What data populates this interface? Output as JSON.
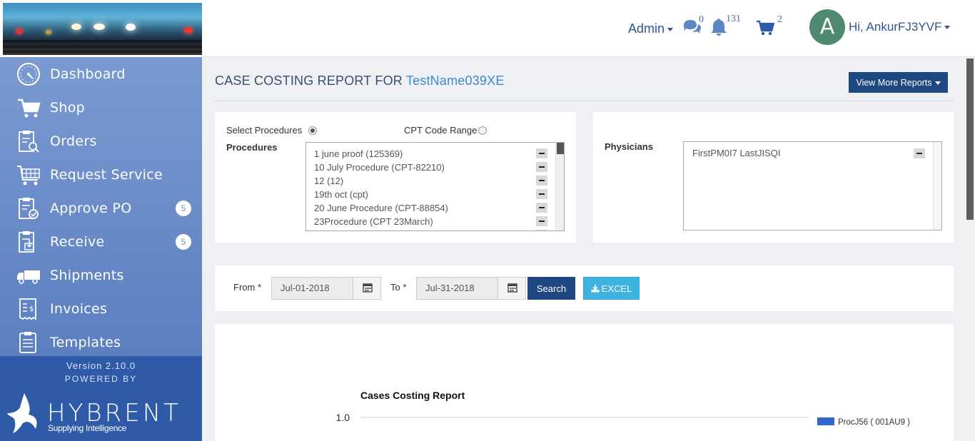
{
  "header": {
    "admin_label": "Admin",
    "messages_count": "0",
    "notifications_count": "131",
    "cart_count": "2",
    "avatar_letter": "A",
    "user_greeting": "Hi, AnkurFJ3YVF"
  },
  "sidebar": {
    "items": [
      {
        "label": "Dashboard",
        "icon": "dashboard-gauge-icon"
      },
      {
        "label": "Shop",
        "icon": "shopping-cart-icon"
      },
      {
        "label": "Orders",
        "icon": "clipboard-search-icon"
      },
      {
        "label": "Request Service",
        "icon": "cart-grid-icon"
      },
      {
        "label": "Approve PO",
        "icon": "clipboard-check-icon",
        "badge": "5"
      },
      {
        "label": "Receive",
        "icon": "clipboard-download-icon",
        "badge": "5"
      },
      {
        "label": "Shipments",
        "icon": "truck-icon"
      },
      {
        "label": "Invoices",
        "icon": "invoice-dollar-icon"
      },
      {
        "label": "Templates",
        "icon": "clipboard-list-icon"
      }
    ],
    "version": "Version 2.10.0",
    "powered_by": "POWERED BY",
    "brand_name": "HYBRENT",
    "brand_tagline": "Supplying Intelligence"
  },
  "main": {
    "title_prefix": "CASE COSTING REPORT FOR",
    "title_name": "TestName039XE",
    "more_reports_label": "View More Reports",
    "select_procedures_label": "Select Procedures",
    "cpt_range_label": "CPT Code Range",
    "procedures_label": "Procedures",
    "procedures": [
      "1 june proof (125369)",
      "10 July Procedure (CPT-82210)",
      "12 (12)",
      "19th oct (cpt)",
      "20 June Procedure (CPT-88854)",
      "23Procedure (CPT 23March)"
    ],
    "physicians_label": "Physicians",
    "physicians": [
      "FirstPM0I7 LastJISQI"
    ],
    "from_label": "From *",
    "from_value": "Jul-01-2018",
    "to_label": "To *",
    "to_value": "Jul-31-2018",
    "search_label": "Search",
    "excel_label": "EXCEL"
  },
  "chart_data": {
    "type": "bar",
    "title": "Cases Costing Report",
    "y_tick_labels": [
      "1.0"
    ],
    "series": [
      {
        "name": "ProcJ56 ( 001AU9 )",
        "color": "#3366cc"
      }
    ]
  },
  "colors": {
    "sidebar": "#6c8fcb",
    "primary_button": "#1f4880",
    "excel_button": "#3fb3e0",
    "title_highlight": "#3e8ad2"
  }
}
